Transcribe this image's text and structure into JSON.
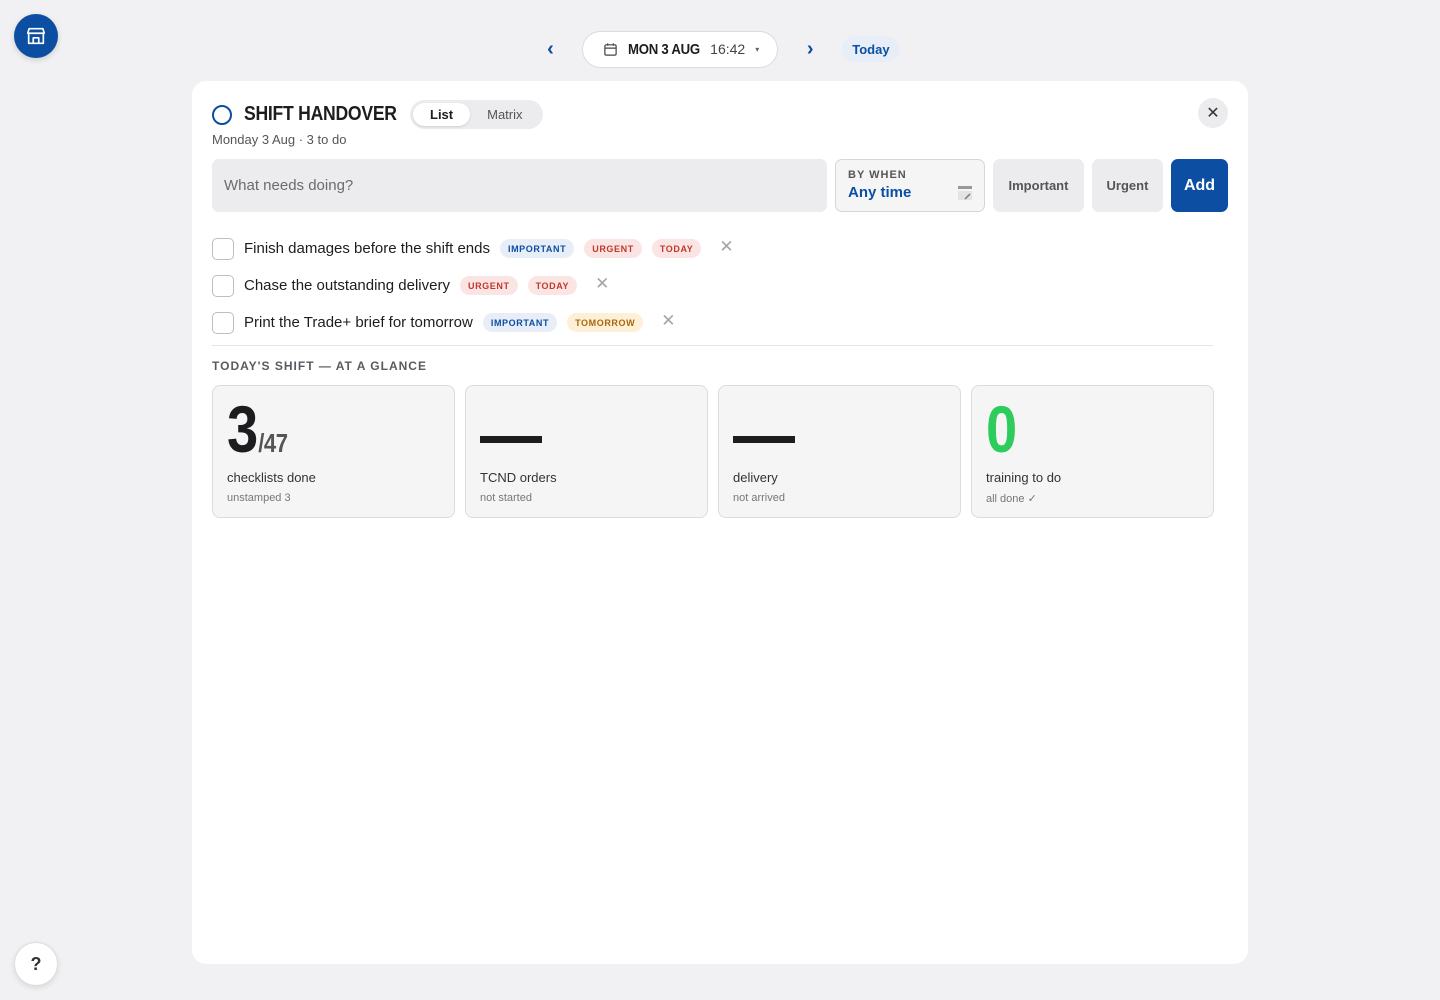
{
  "datebar": {
    "prev": "‹",
    "next": "›",
    "date": "MON 3 AUG",
    "time": "16:42",
    "caret": "▾",
    "today": "Today"
  },
  "help": {
    "label": "?"
  },
  "panel": {
    "title": "SHIFT HANDOVER",
    "subtitle": "Monday 3 Aug · 3 to do",
    "views": [
      "List",
      "Matrix"
    ],
    "active_view": "List",
    "close": "✕",
    "input": {
      "placeholder": "What needs doing?",
      "value": ""
    },
    "bywhen": {
      "label": "BY WHEN",
      "value": "Any time"
    },
    "important_label": "Important",
    "urgent_label": "Urgent",
    "add_label": "Add",
    "tasks": [
      {
        "text": "Finish damages before the shift ends",
        "tags": [
          {
            "label": "IMPORTANT",
            "kind": "important"
          },
          {
            "label": "URGENT",
            "kind": "urgent"
          },
          {
            "label": "TODAY",
            "kind": "today"
          }
        ]
      },
      {
        "text": "Chase the outstanding delivery",
        "tags": [
          {
            "label": "URGENT",
            "kind": "urgent"
          },
          {
            "label": "TODAY",
            "kind": "today"
          }
        ]
      },
      {
        "text": "Print the Trade+ brief for tomorrow",
        "tags": [
          {
            "label": "IMPORTANT",
            "kind": "important"
          },
          {
            "label": "TOMORROW",
            "kind": "tomorrow"
          }
        ]
      }
    ],
    "remove_glyph": "✕",
    "glance": {
      "title": "TODAY'S SHIFT — AT A GLANCE",
      "cards": [
        {
          "value": "3",
          "denominator": "/47",
          "label": "checklists done",
          "sub": "unstamped 3",
          "style": "number"
        },
        {
          "value": "",
          "label": "TCND orders",
          "sub": "not started",
          "style": "dash"
        },
        {
          "value": "",
          "label": "delivery",
          "sub": "not arrived",
          "style": "dash"
        },
        {
          "value": "0",
          "label": "training to do",
          "sub": "all done ✓",
          "style": "green"
        }
      ]
    }
  },
  "colors": {
    "brand": "#0b4ea2",
    "success": "#2ecc5a",
    "danger": "#c0392b",
    "warning": "#a8660b"
  }
}
